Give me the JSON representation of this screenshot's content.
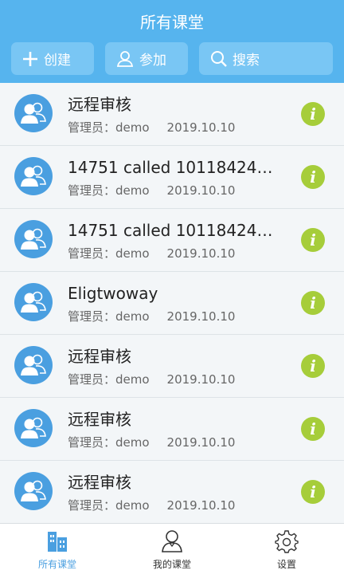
{
  "header": {
    "title": "所有课堂"
  },
  "toolbar": {
    "create_label": "创建",
    "join_label": "参加",
    "search_label": "搜索"
  },
  "icons": {
    "create": "plus-icon",
    "join": "person-icon",
    "search": "search-icon",
    "avatar": "group-icon",
    "info": "info-icon"
  },
  "colors": {
    "header": "#56b4ee",
    "button": "#79c6f4",
    "avatar": "#4a9fe0",
    "info": "#a6cd3a",
    "tab_active": "#4a9fe0"
  },
  "items": [
    {
      "title": "远程审核",
      "admin": "管理员：demo",
      "date": "2019.10.10"
    },
    {
      "title": "14751 called 1011842422...",
      "admin": "管理员：demo",
      "date": "2019.10.10"
    },
    {
      "title": "14751 called 1011842422...",
      "admin": "管理员：demo",
      "date": "2019.10.10"
    },
    {
      "title": "Eligtwoway",
      "admin": "管理员：demo",
      "date": "2019.10.10"
    },
    {
      "title": "远程审核",
      "admin": "管理员：demo",
      "date": "2019.10.10"
    },
    {
      "title": "远程审核",
      "admin": "管理员：demo",
      "date": "2019.10.10"
    },
    {
      "title": "远程审核",
      "admin": "管理员：demo",
      "date": "2019.10.10"
    }
  ],
  "info_glyph": "i",
  "tabs": [
    {
      "label": "所有课堂",
      "icon": "classroom-icon",
      "active": true
    },
    {
      "label": "我的课堂",
      "icon": "user-icon",
      "active": false
    },
    {
      "label": "设置",
      "icon": "gear-icon",
      "active": false
    }
  ]
}
